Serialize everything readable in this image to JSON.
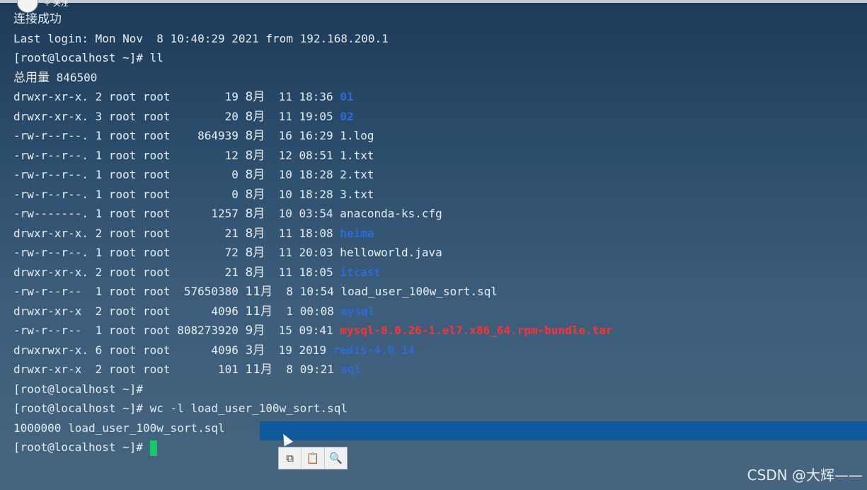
{
  "follow_label": "+ 关注",
  "lines": [
    {
      "parts": [
        {
          "t": "连接成功",
          "c": "cjk"
        }
      ]
    },
    {
      "parts": [
        {
          "t": "Last login: Mon Nov  8 10:40:29 2021 from 192.168.200.1"
        }
      ]
    },
    {
      "parts": [
        {
          "t": "[root@localhost ~]# ll"
        }
      ]
    },
    {
      "parts": [
        {
          "t": "总用量",
          "c": "cjk"
        },
        {
          "t": " 846500"
        }
      ]
    },
    {
      "parts": [
        {
          "t": "drwxr-xr-x. 2 root root        19 "
        },
        {
          "t": "8月",
          "c": "cjk"
        },
        {
          "t": "  11 18:36 "
        },
        {
          "t": "01",
          "c": "dir"
        }
      ]
    },
    {
      "parts": [
        {
          "t": "drwxr-xr-x. 3 root root        20 "
        },
        {
          "t": "8月",
          "c": "cjk"
        },
        {
          "t": "  11 19:05 "
        },
        {
          "t": "02",
          "c": "dir"
        }
      ]
    },
    {
      "parts": [
        {
          "t": "-rw-r--r--. 1 root root    864939 "
        },
        {
          "t": "8月",
          "c": "cjk"
        },
        {
          "t": "  16 16:29 1.log"
        }
      ]
    },
    {
      "parts": [
        {
          "t": "-rw-r--r--. 1 root root        12 "
        },
        {
          "t": "8月",
          "c": "cjk"
        },
        {
          "t": "  12 08:51 1.txt"
        }
      ]
    },
    {
      "parts": [
        {
          "t": "-rw-r--r--. 1 root root         0 "
        },
        {
          "t": "8月",
          "c": "cjk"
        },
        {
          "t": "  10 18:28 2.txt"
        }
      ]
    },
    {
      "parts": [
        {
          "t": "-rw-r--r--. 1 root root         0 "
        },
        {
          "t": "8月",
          "c": "cjk"
        },
        {
          "t": "  10 18:28 3.txt"
        }
      ]
    },
    {
      "parts": [
        {
          "t": "-rw-------. 1 root root      1257 "
        },
        {
          "t": "8月",
          "c": "cjk"
        },
        {
          "t": "  10 03:54 anaconda-ks.cfg"
        }
      ]
    },
    {
      "parts": [
        {
          "t": "drwxr-xr-x. 2 root root        21 "
        },
        {
          "t": "8月",
          "c": "cjk"
        },
        {
          "t": "  11 18:08 "
        },
        {
          "t": "heima",
          "c": "dir"
        }
      ]
    },
    {
      "parts": [
        {
          "t": "-rw-r--r--. 1 root root        72 "
        },
        {
          "t": "8月",
          "c": "cjk"
        },
        {
          "t": "  11 20:03 helloworld.java"
        }
      ]
    },
    {
      "parts": [
        {
          "t": "drwxr-xr-x. 2 root root        21 "
        },
        {
          "t": "8月",
          "c": "cjk"
        },
        {
          "t": "  11 18:05 "
        },
        {
          "t": "itcast",
          "c": "dir"
        }
      ]
    },
    {
      "parts": [
        {
          "t": "-rw-r--r--  1 root root  57650380 "
        },
        {
          "t": "11月",
          "c": "cjk"
        },
        {
          "t": "  8 10:54 load_user_100w_sort.sql"
        }
      ]
    },
    {
      "parts": [
        {
          "t": "drwxr-xr-x  2 root root      4096 "
        },
        {
          "t": "11月",
          "c": "cjk"
        },
        {
          "t": "  1 00:08 "
        },
        {
          "t": "mysql",
          "c": "dir"
        }
      ]
    },
    {
      "parts": [
        {
          "t": "-rw-r--r--  1 root root 808273920 "
        },
        {
          "t": "9月",
          "c": "cjk"
        },
        {
          "t": "  15 09:41 "
        },
        {
          "t": "mysql-8.0.26-1.el7.x86_64.rpm-bundle.tar",
          "c": "red"
        }
      ]
    },
    {
      "parts": [
        {
          "t": "drwxrwxr-x. 6 root root      4096 "
        },
        {
          "t": "3月",
          "c": "cjk"
        },
        {
          "t": "  19 2019 "
        },
        {
          "t": "redis-4.0.14",
          "c": "dir"
        }
      ]
    },
    {
      "parts": [
        {
          "t": "drwxr-xr-x  2 root root       101 "
        },
        {
          "t": "11月",
          "c": "cjk"
        },
        {
          "t": "  8 09:21 "
        },
        {
          "t": "sql",
          "c": "dir"
        }
      ]
    },
    {
      "parts": [
        {
          "t": "[root@localhost ~]#"
        }
      ]
    },
    {
      "parts": [
        {
          "t": "[root@localhost ~]# wc -l load_user_100w_sort.sql"
        }
      ]
    },
    {
      "parts": [
        {
          "t": "1000000 load_user_100w_sort.sql"
        }
      ]
    },
    {
      "parts": [
        {
          "t": "[root@localhost ~]#"
        }
      ],
      "cursor": true
    }
  ],
  "toolbar": [
    {
      "name": "copy-icon",
      "glyph": "⧉"
    },
    {
      "name": "paste-icon",
      "glyph": "📋"
    },
    {
      "name": "search-icon",
      "glyph": "🔍"
    }
  ],
  "watermark": "CSDN @大辉——"
}
